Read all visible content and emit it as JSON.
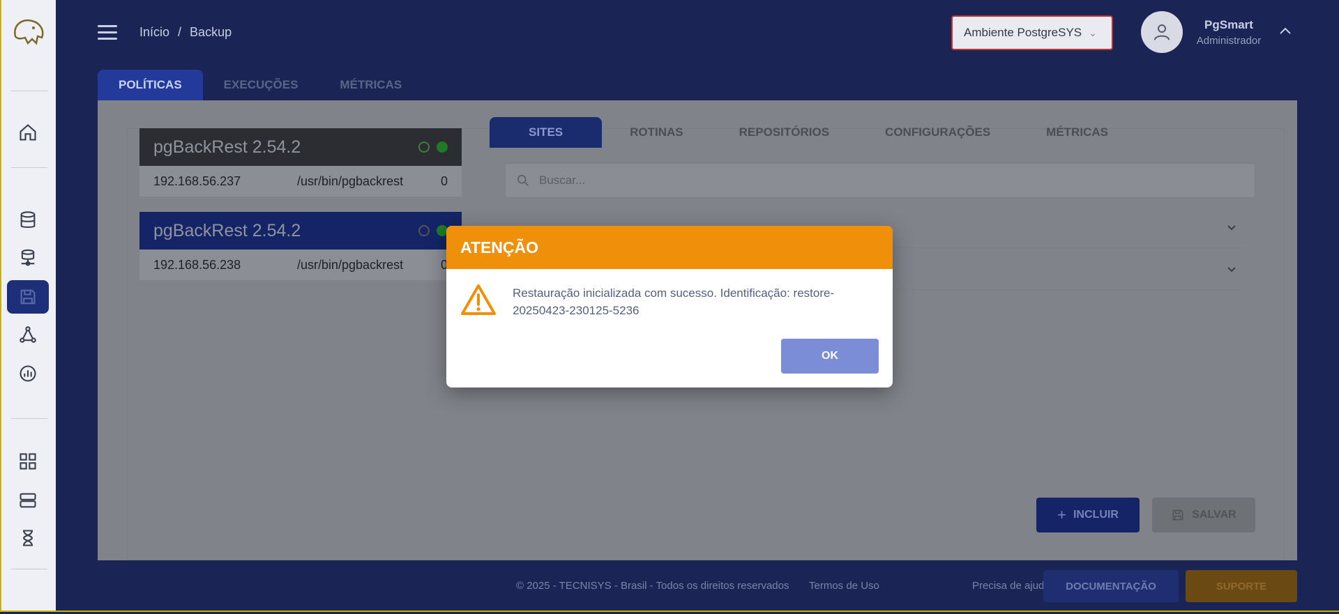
{
  "header": {
    "breadcrumb": [
      "Início",
      "/",
      "Backup"
    ],
    "environment": "Ambiente PostgreSYS",
    "user": {
      "name": "PgSmart",
      "role": "Administrador"
    }
  },
  "top_tabs": [
    {
      "label": "POLÍTICAS",
      "active": true
    },
    {
      "label": "EXECUÇÕES",
      "active": false
    },
    {
      "label": "MÉTRICAS",
      "active": false
    }
  ],
  "nodes": [
    {
      "title": "pgBackRest 2.54.2",
      "ip": "192.168.56.237",
      "path": "/usr/bin/pgbackrest",
      "count": "0"
    },
    {
      "title": "pgBackRest 2.54.2",
      "ip": "192.168.56.238",
      "path": "/usr/bin/pgbackrest",
      "count": "0"
    }
  ],
  "sub_tabs": [
    {
      "label": "SITES",
      "active": true
    },
    {
      "label": "ROTINAS",
      "active": false
    },
    {
      "label": "REPOSITÓRIOS",
      "active": false
    },
    {
      "label": "CONFIGURAÇÕES",
      "active": false
    },
    {
      "label": "MÉTRICAS",
      "active": false
    }
  ],
  "search": {
    "placeholder": "Buscar..."
  },
  "actions": {
    "include": "INCLUIR",
    "save": "SALVAR"
  },
  "footer": {
    "copyright": "© 2025 - TECNISYS - Brasil - Todos os direitos reservados",
    "terms": "Termos de Uso",
    "help": "Precisa de ajuda?",
    "docs": "DOCUMENTAÇÃO",
    "support": "SUPORTE"
  },
  "modal": {
    "title": "ATENÇÃO",
    "message": "Restauração inicializada com sucesso. Identificação: restore-20250423-230125-5236",
    "ok": "OK"
  },
  "colors": {
    "accent": "#f0900a",
    "primary": "#233a9a",
    "ok_button": "#7b8dd6"
  }
}
